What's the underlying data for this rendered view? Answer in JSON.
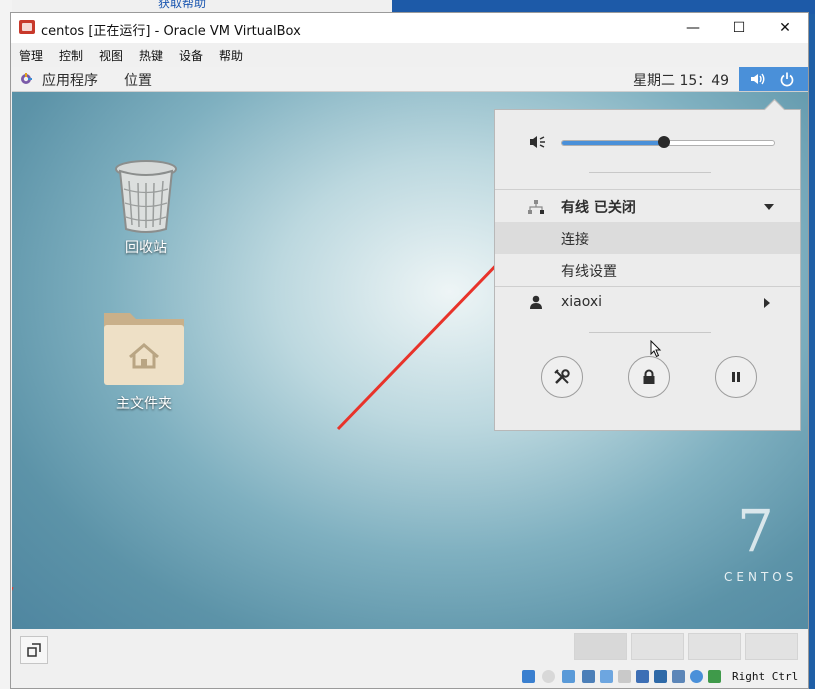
{
  "window": {
    "title": "centos [正在运行] - Oracle VM VirtualBox",
    "background_link": "获取帮助",
    "controls": {
      "minimize": "—",
      "maximize": "☐",
      "close": "✕"
    }
  },
  "menubar": {
    "items": [
      "管理",
      "控制",
      "视图",
      "热键",
      "设备",
      "帮助"
    ]
  },
  "guest": {
    "topbar": {
      "applications": "应用程序",
      "places": "位置",
      "clock": "星期二 15：49"
    },
    "desktop_icons": [
      {
        "label": "回收站",
        "icon": "trash-icon"
      },
      {
        "label": "主文件夹",
        "icon": "home-folder-icon"
      }
    ],
    "branding": {
      "version": "7",
      "name": "CENTOS"
    },
    "system_menu": {
      "volume": {
        "level": 0.48
      },
      "network": {
        "title": "有线  已关闭",
        "items": [
          "连接",
          "有线设置"
        ]
      },
      "user": {
        "name": "xiaoxi"
      },
      "buttons": [
        "settings-icon",
        "lock-icon",
        "pause-icon"
      ]
    }
  },
  "statusbar": {
    "host_key": "Right Ctrl"
  },
  "colors": {
    "accent": "#4a90d9",
    "arrow": "#e8332a"
  }
}
